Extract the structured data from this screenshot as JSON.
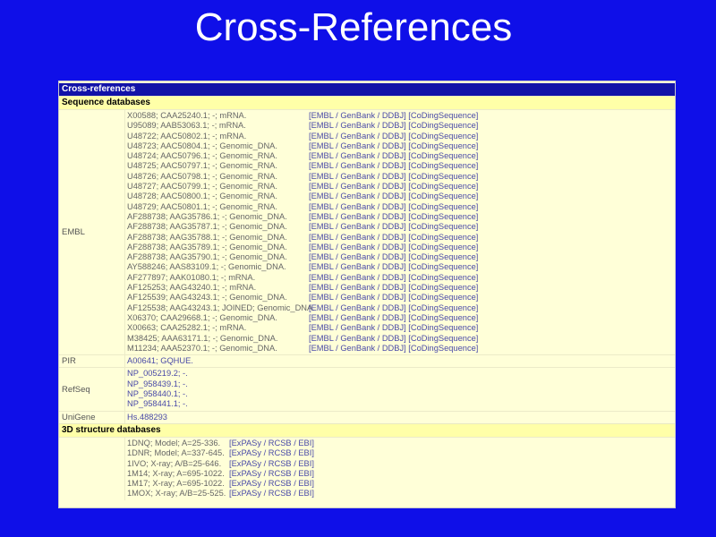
{
  "slide_title": "Cross-References",
  "panel": {
    "header": "Cross-references",
    "sections": {
      "sequence": {
        "title": "Sequence databases",
        "embl": {
          "label": "EMBL",
          "links": [
            "EMBL",
            "GenBank",
            "DDBJ",
            "CoDingSequence"
          ],
          "rows": [
            "X00588; CAA25240.1; -; mRNA.",
            "U95089; AAB53063.1; -; mRNA.",
            "U48722; AAC50802.1; -; mRNA.",
            "U48723; AAC50804.1; -; Genomic_DNA.",
            "U48724; AAC50796.1; -; Genomic_RNA.",
            "U48725; AAC50797.1; -; Genomic_RNA.",
            "U48726; AAC50798.1; -; Genomic_RNA.",
            "U48727; AAC50799.1; -; Genomic_RNA.",
            "U48728; AAC50800.1; -; Genomic_RNA.",
            "U48729; AAC50801.1; -; Genomic_RNA.",
            "AF288738; AAG35786.1; -; Genomic_DNA.",
            "AF288738; AAG35787.1; -; Genomic_DNA.",
            "AF288738; AAG35788.1; -; Genomic_DNA.",
            "AF288738; AAG35789.1; -; Genomic_DNA.",
            "AF288738; AAG35790.1; -; Genomic_DNA.",
            "AY588246; AAS83109.1; -; Genomic_DNA.",
            "AF277897; AAK01080.1; -; mRNA.",
            "AF125253; AAG43240.1; -; mRNA.",
            "AF125539; AAG43243.1; -; Genomic_DNA.",
            "AF125538; AAG43243.1; JOINED; Genomic_DNA.",
            "X06370; CAA29668.1; -; Genomic_DNA.",
            "X00663; CAA25282.1; -; mRNA.",
            "M38425; AAA63171.1; -; Genomic_DNA.",
            "M11234; AAA52370.1; -; Genomic_DNA."
          ]
        },
        "pir": {
          "label": "PIR",
          "rows": [
            "A00641; GQHUE."
          ]
        },
        "refseq": {
          "label": "RefSeq",
          "rows": [
            "NP_005219.2; -.",
            "NP_958439.1; -.",
            "NP_958440.1; -.",
            "NP_958441.1; -."
          ]
        },
        "unigene": {
          "label": "UniGene",
          "rows": [
            "Hs.488293"
          ]
        }
      },
      "structure": {
        "title": "3D structure databases",
        "links": [
          "ExPASy",
          "RCSB",
          "EBI"
        ],
        "rows": [
          "1DNQ; Model; A=25-336.",
          "1DNR; Model; A=337-645.",
          "1IVO; X-ray; A/B=25-646.",
          "1M14; X-ray; A=695-1022.",
          "1M17; X-ray; A=695-1022.",
          "1MOX; X-ray; A/B=25-525."
        ]
      }
    }
  }
}
